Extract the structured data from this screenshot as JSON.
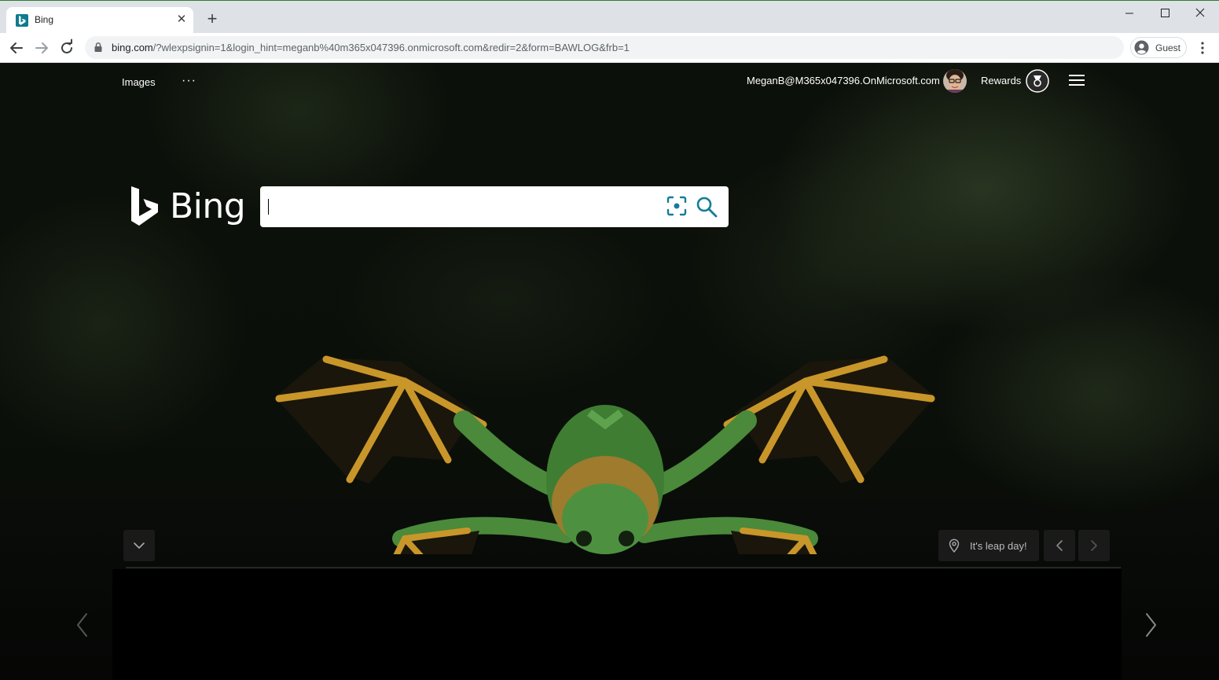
{
  "browser": {
    "tab": {
      "title": "Bing",
      "close_glyph": "✕"
    },
    "new_tab_glyph": "+",
    "address": {
      "host": "bing.com",
      "path": "/?wlexpsignin=1&login_hint=meganb%40m365x047396.onmicrosoft.com&redir=2&form=BAWLOG&frb=1"
    },
    "profile": {
      "label": "Guest"
    }
  },
  "header": {
    "links": {
      "images": "Images",
      "more": "···"
    },
    "account": {
      "email": "MeganB@M365x047396.OnMicrosoft.com"
    },
    "rewards": {
      "label": "Rewards"
    }
  },
  "search": {
    "brand": "Bing",
    "value": "",
    "placeholder": ""
  },
  "image_info": {
    "caption": "It's leap day!"
  },
  "colors": {
    "accent": "#0e7a8f",
    "search_icon": "#157d97",
    "page_bg": "#0b0f09"
  },
  "icons": [
    "bing-favicon-icon",
    "close-icon",
    "plus-icon",
    "minimize-icon",
    "maximize-icon",
    "close-window-icon",
    "back-arrow-icon",
    "forward-arrow-icon",
    "reload-icon",
    "lock-icon",
    "profile-icon",
    "kebab-menu-icon",
    "avatar",
    "rewards-medal-icon",
    "hamburger-menu-icon",
    "bing-logo-icon",
    "visual-search-icon",
    "search-icon",
    "chevron-down-icon",
    "location-pin-icon",
    "chevron-left-icon",
    "chevron-right-icon"
  ]
}
